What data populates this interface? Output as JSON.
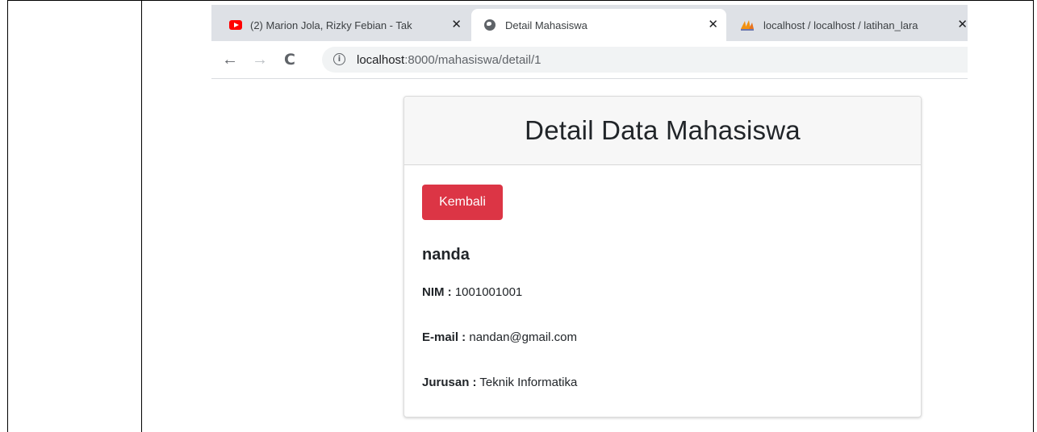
{
  "browser": {
    "tabs": [
      {
        "title": "(2) Marion Jola, Rizky Febian - Tak",
        "icon": "youtube-icon",
        "close": "✕"
      },
      {
        "title": "Detail Mahasiswa",
        "icon": "globe-icon",
        "close": "✕"
      },
      {
        "title": "localhost / localhost / latihan_lara",
        "icon": "phpmyadmin-icon",
        "close": "✕"
      }
    ],
    "nav": {
      "back": "←",
      "forward": "→",
      "reload": "C"
    },
    "address": {
      "host": "localhost",
      "path": ":8000/mahasiswa/detail/1",
      "info": "i"
    }
  },
  "page": {
    "heading": "Detail Data Mahasiswa",
    "back_button": "Kembali",
    "student": {
      "name": "nanda",
      "nim_label": "NIM :",
      "nim": "1001001001",
      "email_label": "E-mail :",
      "email": "nandan@gmail.com",
      "jurusan_label": "Jurusan :",
      "jurusan": "Teknik Informatika"
    }
  },
  "colors": {
    "danger": "#dc3545",
    "tabstrip": "#dee1e6",
    "omnibox": "#f1f3f4"
  }
}
